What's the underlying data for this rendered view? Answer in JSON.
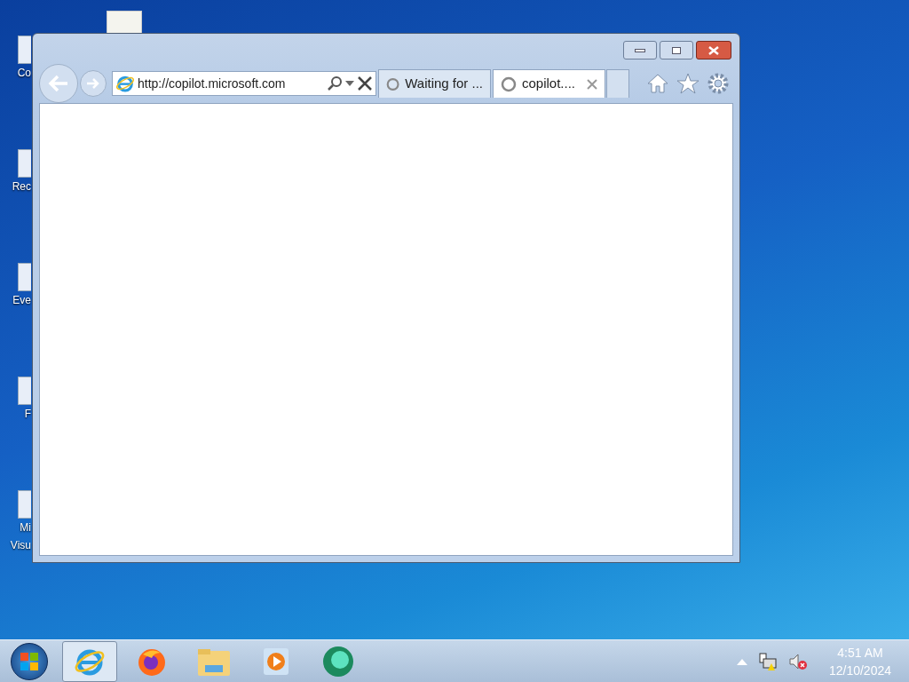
{
  "desktop_icons": [
    {
      "lines": [
        "Co"
      ]
    },
    {
      "lines": [
        "Rec"
      ]
    },
    {
      "lines": [
        "Eve"
      ]
    },
    {
      "lines": [
        "F"
      ]
    },
    {
      "lines": [
        "Mi",
        "Visu"
      ]
    }
  ],
  "browser": {
    "url": "http://copilot.microsoft.com",
    "tabs": [
      {
        "label": "Waiting for ...",
        "selected": false
      },
      {
        "label": "copilot....",
        "selected": true
      }
    ]
  },
  "taskbar": {
    "apps": [
      {
        "kind": "ie",
        "selected": true
      },
      {
        "kind": "firefox",
        "selected": false
      },
      {
        "kind": "folder",
        "selected": false
      },
      {
        "kind": "media",
        "selected": false
      },
      {
        "kind": "teal",
        "selected": false
      }
    ],
    "time": "4:51 AM",
    "date": "12/10/2024"
  }
}
